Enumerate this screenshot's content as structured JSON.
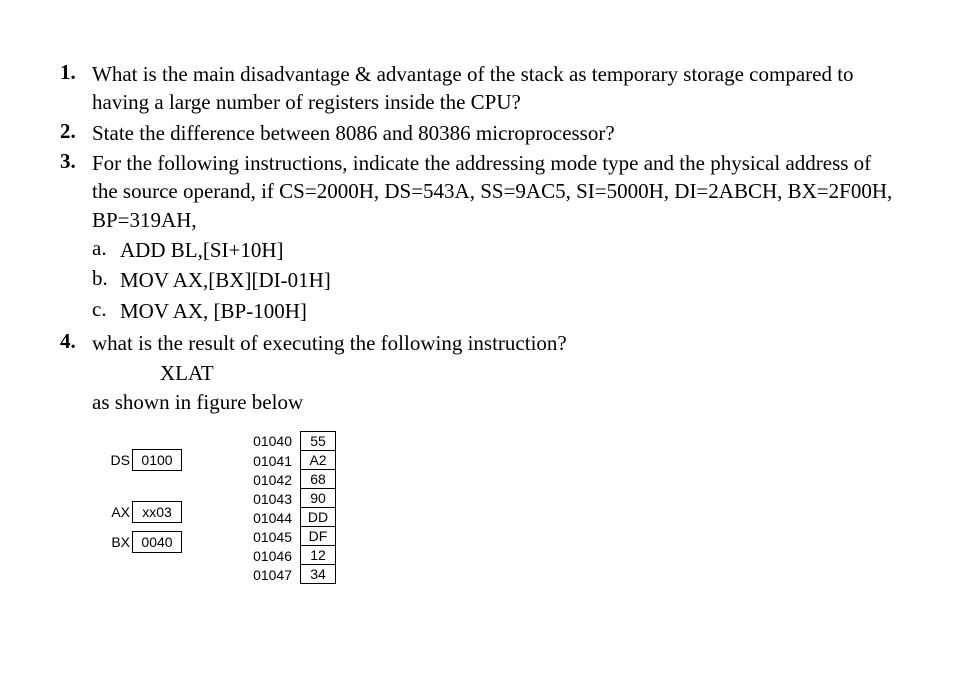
{
  "questions": {
    "q1": {
      "num": "1.",
      "text": "What is the main disadvantage & advantage of the stack as temporary storage compared to having a large number of registers inside the CPU?"
    },
    "q2": {
      "num": "2.",
      "text": "State the difference between 8086 and 80386 microprocessor?"
    },
    "q3": {
      "num": "3.",
      "intro": "For the following instructions, indicate the addressing mode type and the physical address of the source operand, if CS=2000H,  DS=543A, SS=9AC5,   SI=5000H,   DI=2ABCH,   BX=2F00H,   BP=319AH,",
      "a": {
        "letter": "a.",
        "text": "ADD BL,[SI+10H]"
      },
      "b": {
        "letter": "b.",
        "text": "MOV AX,[BX][DI-01H]"
      },
      "c": {
        "letter": "c.",
        "text": "MOV AX, [BP-100H]"
      }
    },
    "q4": {
      "num": "4.",
      "text": "what is the result of executing the following instruction?",
      "instr": "XLAT",
      "caption": "as shown in figure below"
    }
  },
  "registers": {
    "ds": {
      "label": "DS",
      "value": "0100"
    },
    "ax": {
      "label": "AX",
      "value": "xx03"
    },
    "bx": {
      "label": "BX",
      "value": "0040"
    }
  },
  "memory": [
    {
      "addr": "01040",
      "val": "55"
    },
    {
      "addr": "01041",
      "val": "A2"
    },
    {
      "addr": "01042",
      "val": "68"
    },
    {
      "addr": "01043",
      "val": "90"
    },
    {
      "addr": "01044",
      "val": "DD"
    },
    {
      "addr": "01045",
      "val": "DF"
    },
    {
      "addr": "01046",
      "val": "12"
    },
    {
      "addr": "01047",
      "val": "34"
    }
  ]
}
